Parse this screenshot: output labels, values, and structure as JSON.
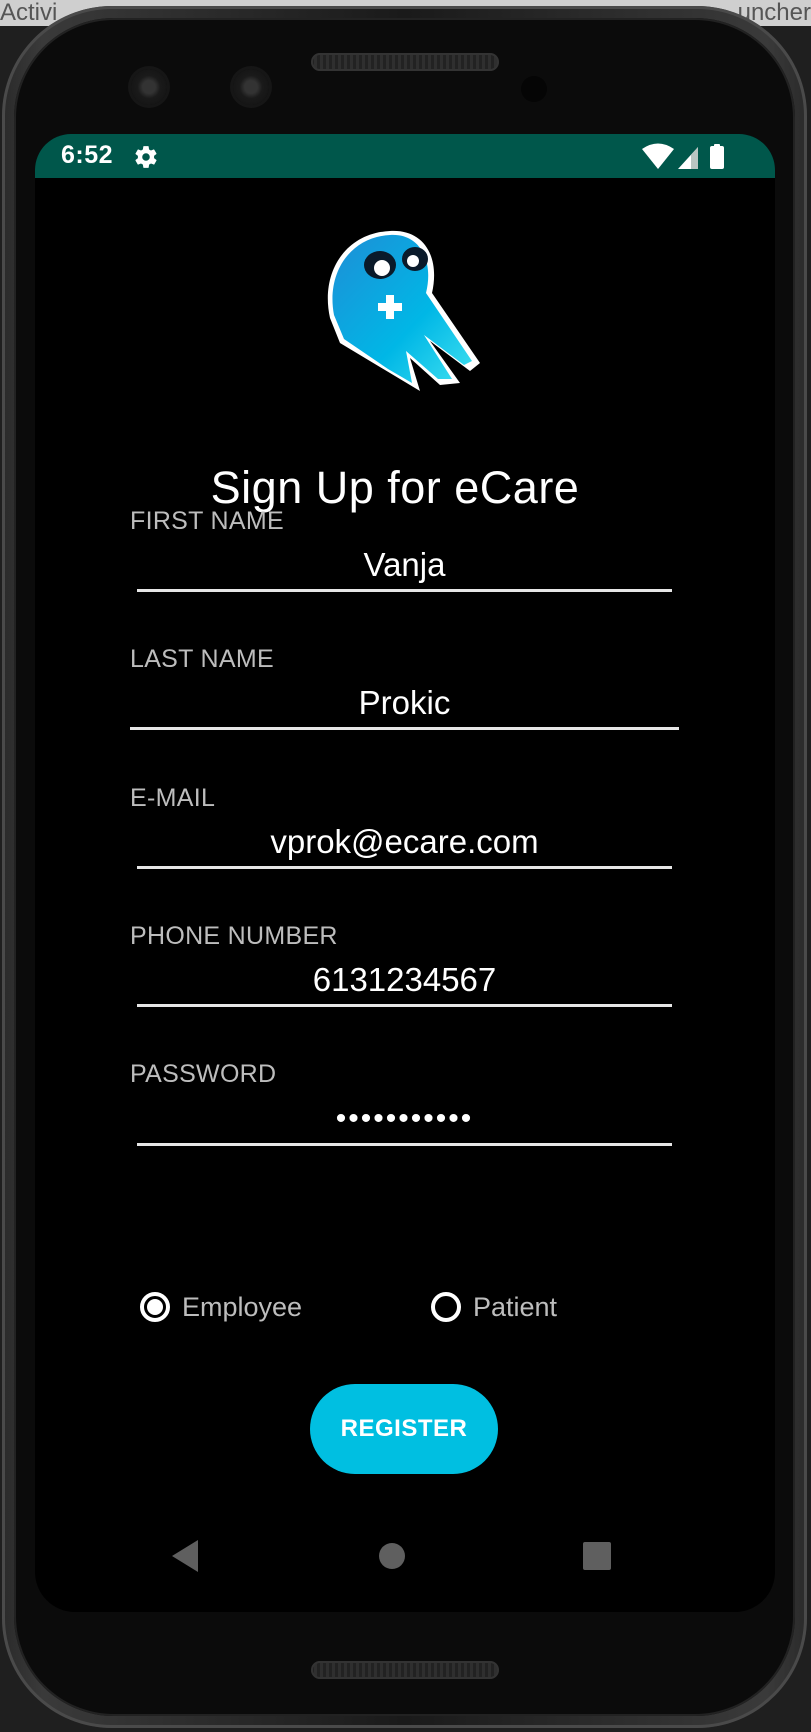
{
  "host": {
    "left_text": "Activi",
    "right_text": "uncher"
  },
  "status_bar": {
    "time": "6:52",
    "icons": [
      "gear-icon",
      "wifi-icon",
      "cell-signal-icon",
      "battery-icon"
    ]
  },
  "screen": {
    "title": "Sign Up for eCare",
    "fields": {
      "first_name": {
        "label": "FIRST NAME",
        "value": "Vanja"
      },
      "last_name": {
        "label": "LAST NAME",
        "value": "Prokic"
      },
      "email": {
        "label": "E-MAIL",
        "value": "vprok@ecare.com"
      },
      "phone": {
        "label": "PHONE NUMBER",
        "value": "6131234567"
      },
      "password": {
        "label": "PASSWORD",
        "value": "•••••••••••"
      }
    },
    "role": {
      "options": [
        "Employee",
        "Patient"
      ],
      "selected": "Employee"
    },
    "register_label": "REGISTER"
  },
  "colors": {
    "status_bar": "#00574b",
    "accent": "#00bfe1",
    "background": "#000000"
  },
  "nav_bar": {
    "icons": [
      "back-icon",
      "home-icon",
      "recents-icon"
    ]
  }
}
